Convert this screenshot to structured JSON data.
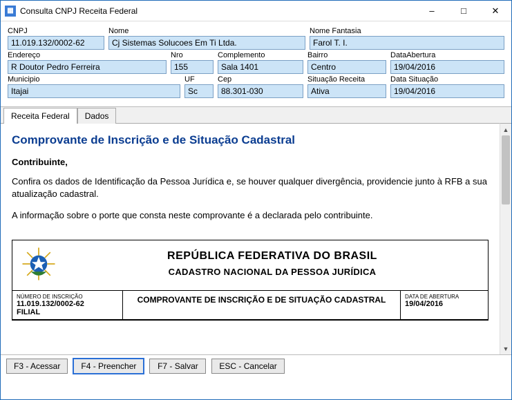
{
  "window": {
    "title": "Consulta CNPJ Receita Federal"
  },
  "fields": {
    "cnpj": {
      "label": "CNPJ",
      "value": "11.019.132/0002-62"
    },
    "nome": {
      "label": "Nome",
      "value": "Cj Sistemas Solucoes Em Ti Ltda."
    },
    "nome_fantasia": {
      "label": "Nome Fantasia",
      "value": "Farol T. I."
    },
    "endereco": {
      "label": "Endereço",
      "value": "R Doutor Pedro Ferreira"
    },
    "nro": {
      "label": "Nro",
      "value": "155"
    },
    "complemento": {
      "label": "Complemento",
      "value": "Sala 1401"
    },
    "bairro": {
      "label": "Bairro",
      "value": "Centro"
    },
    "data_abertura": {
      "label": "DataAbertura",
      "value": "19/04/2016"
    },
    "municipio": {
      "label": "Municipio",
      "value": "Itajai"
    },
    "uf": {
      "label": "UF",
      "value": "Sc"
    },
    "cep": {
      "label": "Cep",
      "value": "88.301-030"
    },
    "situacao_receita": {
      "label": "Situação Receita",
      "value": "Ativa"
    },
    "data_situacao": {
      "label": "Data Situação",
      "value": "19/04/2016"
    }
  },
  "tabs": {
    "receita": "Receita Federal",
    "dados": "Dados"
  },
  "content": {
    "title": "Comprovante de Inscrição e de Situação Cadastral",
    "salutation": "Contribuinte,",
    "p1": "Confira os dados de Identificação da Pessoa Jurídica e, se houver qualquer divergência, providencie junto à RFB a sua atualização cadastral.",
    "p2": "A informação sobre o porte que consta neste comprovante é a declarada pelo contribuinte.",
    "doc": {
      "header1": "REPÚBLICA FEDERATIVA DO BRASIL",
      "header2": "CADASTRO NACIONAL DA PESSOA JURÍDICA",
      "num_insc_label": "NÚMERO DE INSCRIÇÃO",
      "num_insc_value": "11.019.132/0002-62",
      "num_insc_tipo": "FILIAL",
      "mid_title": "COMPROVANTE DE INSCRIÇÃO E DE SITUAÇÃO CADASTRAL",
      "data_ab_label": "DATA DE ABERTURA",
      "data_ab_value": "19/04/2016"
    }
  },
  "footer": {
    "f3": "F3 - Acessar",
    "f4": "F4 - Preencher",
    "f7": "F7 - Salvar",
    "esc": "ESC - Cancelar"
  }
}
